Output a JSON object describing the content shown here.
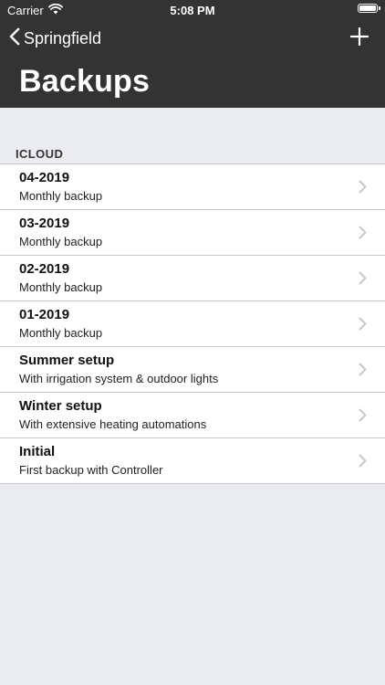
{
  "status_bar": {
    "carrier": "Carrier",
    "time": "5:08 PM",
    "battery_level": 1.0
  },
  "nav": {
    "back_label": "Springfield",
    "back_icon": "chevron-left-icon",
    "add_icon": "plus-icon"
  },
  "page": {
    "title": "Backups"
  },
  "section": {
    "header": "ICLOUD"
  },
  "backups": [
    {
      "title": "04-2019",
      "subtitle": "Monthly backup"
    },
    {
      "title": "03-2019",
      "subtitle": "Monthly backup"
    },
    {
      "title": "02-2019",
      "subtitle": "Monthly backup"
    },
    {
      "title": "01-2019",
      "subtitle": "Monthly backup"
    },
    {
      "title": "Summer setup",
      "subtitle": "With irrigation system & outdoor lights"
    },
    {
      "title": "Winter setup",
      "subtitle": "With extensive heating automations"
    },
    {
      "title": "Initial",
      "subtitle": "First backup with Controller"
    }
  ],
  "colors": {
    "header_bg": "#333333",
    "page_bg": "#eaecf0",
    "row_bg": "#ffffff",
    "separator": "#c8c8cc",
    "chevron": "#c7c7cc"
  }
}
